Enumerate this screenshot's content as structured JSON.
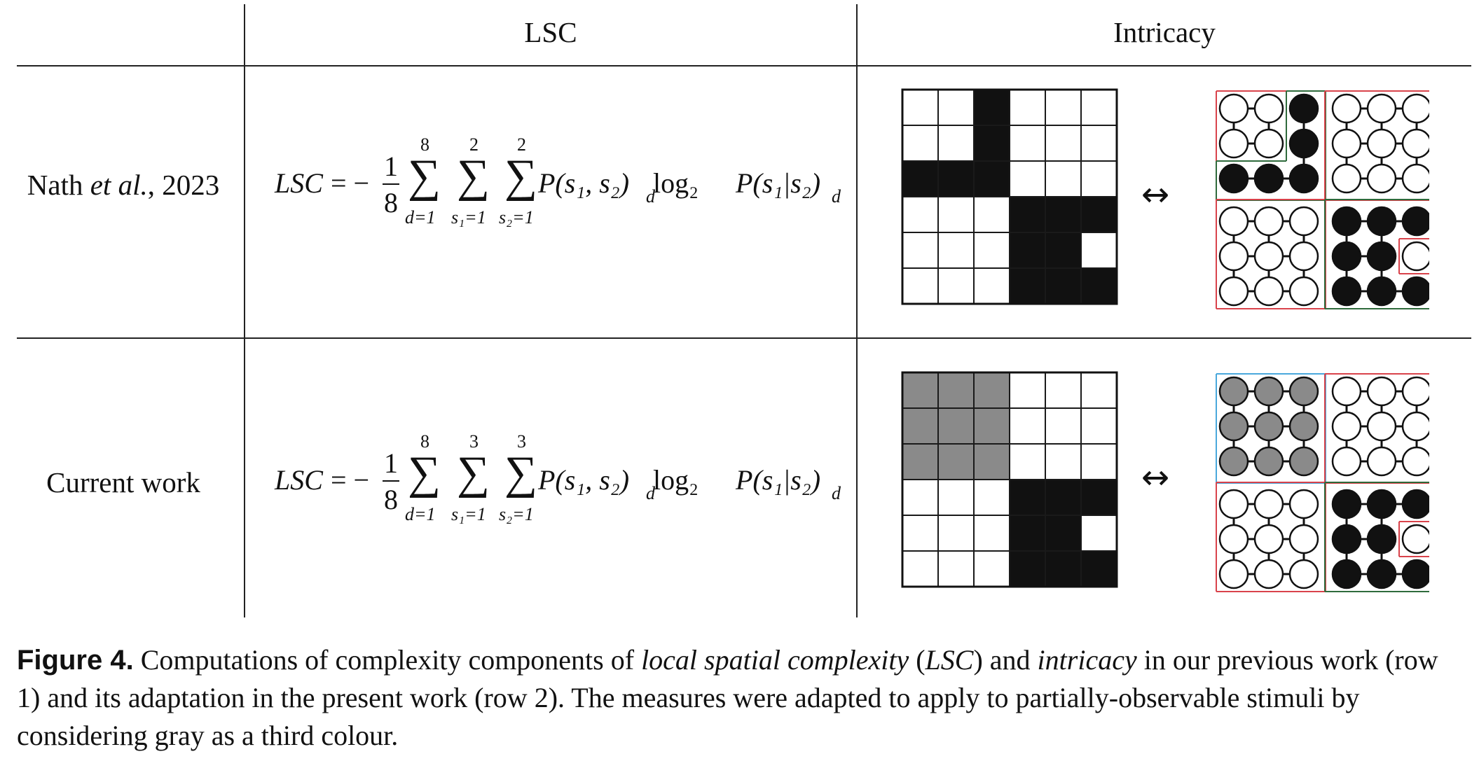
{
  "table": {
    "headers": {
      "col_lsc": "LSC",
      "col_intricacy": "Intricacy"
    },
    "rows": [
      {
        "label_pre": "Nath ",
        "label_it": "et al.",
        "label_post": ", 2023",
        "formula": {
          "lhs": "LSC",
          "eq": "= −",
          "num": "1",
          "den": "8",
          "sum1_top": "8",
          "sum1_bot": "d=1",
          "sum2_top": "2",
          "sum2_bot": "s₁=1",
          "sum3_top": "2",
          "sum3_bot": "s₂=1",
          "body": "P(s₁, s₂)",
          "sub_d1": "d",
          "log": " log₂ ",
          "body2": "P(s₁|s₂)",
          "sub_d2": "d"
        },
        "grid": [
          [
            0,
            0,
            1,
            0,
            0,
            0
          ],
          [
            0,
            0,
            1,
            0,
            0,
            0
          ],
          [
            1,
            1,
            1,
            0,
            0,
            0
          ],
          [
            0,
            0,
            0,
            1,
            1,
            1
          ],
          [
            0,
            0,
            0,
            1,
            1,
            0
          ],
          [
            0,
            0,
            0,
            1,
            1,
            1
          ]
        ],
        "arrow": "↔"
      },
      {
        "label_pre": "Current work",
        "label_it": "",
        "label_post": "",
        "formula": {
          "lhs": "LSC",
          "eq": "= −",
          "num": "1",
          "den": "8",
          "sum1_top": "8",
          "sum1_bot": "d=1",
          "sum2_top": "3",
          "sum2_bot": "s₁=1",
          "sum3_top": "3",
          "sum3_bot": "s₂=1",
          "body": "P(s₁, s₂)",
          "sub_d1": "d",
          "log": " log₂ ",
          "body2": "P(s₁|s₂)",
          "sub_d2": "d"
        },
        "grid": [
          [
            2,
            2,
            2,
            0,
            0,
            0
          ],
          [
            2,
            2,
            2,
            0,
            0,
            0
          ],
          [
            2,
            2,
            2,
            0,
            0,
            0
          ],
          [
            0,
            0,
            0,
            1,
            1,
            1
          ],
          [
            0,
            0,
            0,
            1,
            1,
            0
          ],
          [
            0,
            0,
            0,
            1,
            1,
            1
          ]
        ],
        "arrow": "↔"
      }
    ]
  },
  "colors": {
    "black": "#111111",
    "gray": "#8a8a8a",
    "white": "#ffffff",
    "red_box": "#d9434b",
    "green_box": "#2f6b3c",
    "blue_box": "#4aa8dc"
  },
  "caption": {
    "label": "Figure 4.",
    "t1": " Computations of complexity components of ",
    "it1": "local spatial complexity",
    "t2": " (",
    "it2": "LSC",
    "t3": ") and ",
    "it3": "intricacy",
    "t4": " in our previous work (row 1) and its adaptation in the present work (row 2). The measures were adapted to apply to partially-observable stimuli by considering gray as a third colour."
  }
}
